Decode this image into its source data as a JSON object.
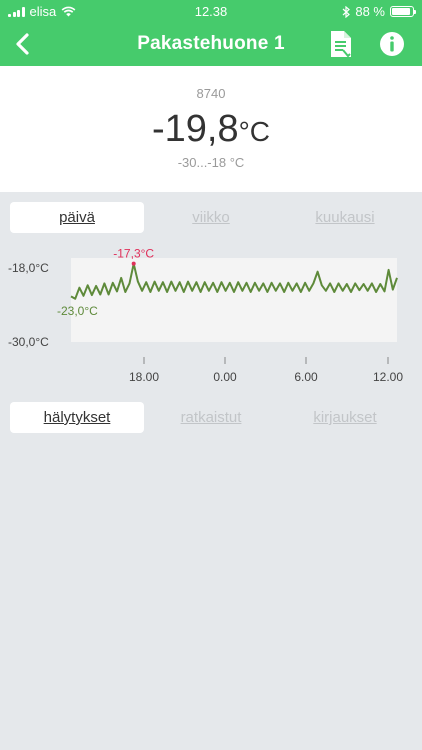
{
  "status_bar": {
    "carrier": "elisa",
    "time": "12.38",
    "battery": "88 %",
    "battery_level": 0.88
  },
  "nav": {
    "title": "Pakastehuone 1",
    "icons": [
      "back-chevron-icon",
      "report-icon",
      "info-icon"
    ]
  },
  "reading": {
    "device_id": "8740",
    "value": "-19,8",
    "unit": "°C",
    "range": "-30...-18 °C"
  },
  "period_tabs": [
    {
      "label": "päivä",
      "active": true
    },
    {
      "label": "viikko",
      "active": false
    },
    {
      "label": "kuukausi",
      "active": false
    }
  ],
  "chart_data": {
    "type": "line",
    "y_top_label": "-18,0°C",
    "y_bottom_label": "-30,0°C",
    "ylim": [
      -30,
      -18
    ],
    "x_ticks": [
      "18.00",
      "0.00",
      "6.00",
      "12.00"
    ],
    "max_label": "-17,3°C",
    "min_label": "-23,0°C",
    "series": [
      {
        "color": "#5e8a3a",
        "y": [
          -22.6,
          -23.0,
          -21.2,
          -22.5,
          -20.8,
          -22.4,
          -20.9,
          -22.3,
          -20.5,
          -22.3,
          -20.4,
          -21.8,
          -19.6,
          -21.9,
          -20.5,
          -17.3,
          -20.2,
          -21.7,
          -20.3,
          -21.9,
          -20.2,
          -21.7,
          -20.3,
          -21.9,
          -20.2,
          -21.7,
          -20.3,
          -21.9,
          -20.2,
          -21.7,
          -20.3,
          -21.9,
          -20.3,
          -21.7,
          -20.4,
          -21.9,
          -20.3,
          -21.7,
          -20.4,
          -21.9,
          -20.3,
          -21.7,
          -20.4,
          -21.9,
          -20.4,
          -21.7,
          -20.5,
          -21.9,
          -20.4,
          -21.7,
          -20.5,
          -21.9,
          -20.4,
          -21.7,
          -20.5,
          -21.9,
          -20.4,
          -21.7,
          -20.5,
          -18.6,
          -20.8,
          -21.7,
          -20.5,
          -21.9,
          -20.5,
          -21.7,
          -20.6,
          -21.9,
          -20.5,
          -21.6,
          -20.6,
          -21.7,
          -20.5,
          -21.9,
          -20.6,
          -21.8,
          -18.3,
          -21.5,
          -19.6
        ]
      }
    ],
    "grid": false,
    "background": "#f4f4f4"
  },
  "list_tabs": [
    {
      "label": "hälytykset",
      "active": true
    },
    {
      "label": "ratkaistut",
      "active": false
    },
    {
      "label": "kirjaukset",
      "active": false
    }
  ]
}
